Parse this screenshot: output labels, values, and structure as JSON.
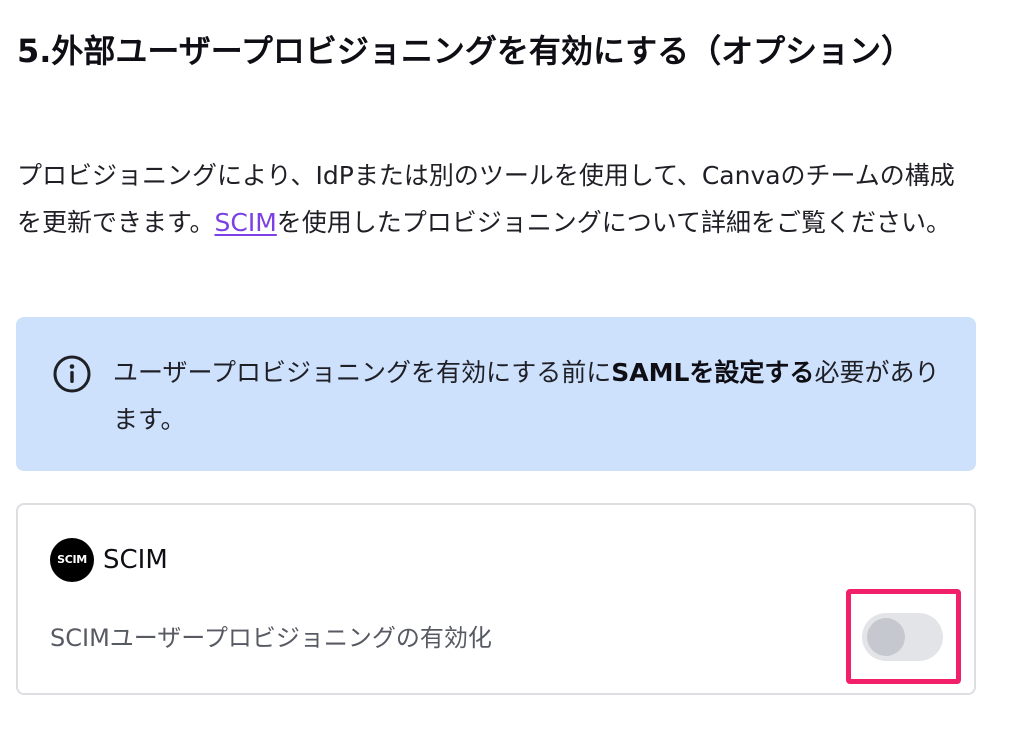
{
  "section": {
    "heading": "5.外部ユーザープロビジョニングを有効にする（オプション）"
  },
  "intro": {
    "text_before_link": "プロビジョニングにより、IdPまたは別のツールを使用して、Canvaのチームの構成を更新できます。",
    "link_text": "SCIM",
    "text_after_link": "を使用したプロビジョニングについて詳細をご覧ください。"
  },
  "notice": {
    "icon": "info-icon",
    "text_before": "ユーザープロビジョニングを有効にする前に",
    "text_bold": "SAMLを設定する",
    "text_after": "必要があります。",
    "background_color": "#cde0fc"
  },
  "scim_card": {
    "logo_text": "SCIM",
    "title": "SCIM",
    "description": "SCIMユーザープロビジョニングの有効化",
    "toggle": {
      "enabled": false
    }
  },
  "colors": {
    "link": "#7b3fe4",
    "highlight": "#f21f6a",
    "toggle_track": "#e3e4e8",
    "toggle_knob": "#c6c8cf"
  }
}
